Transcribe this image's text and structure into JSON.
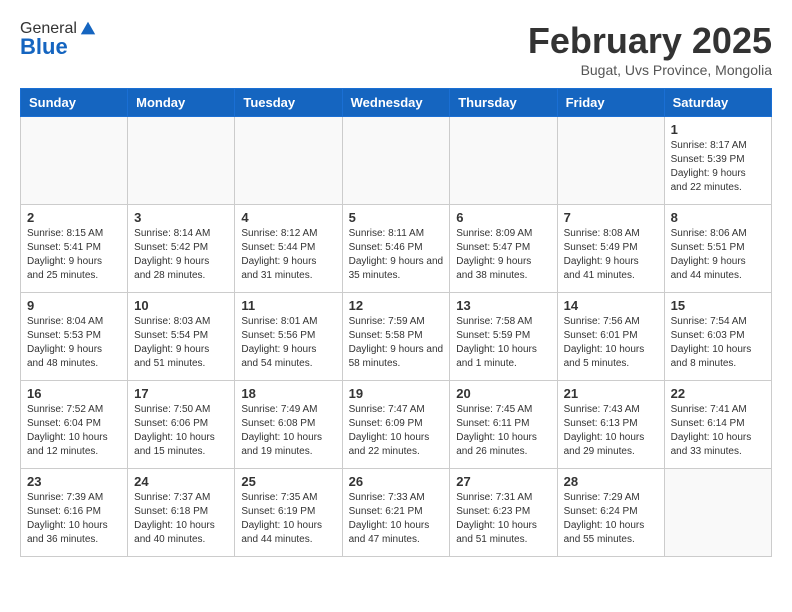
{
  "header": {
    "logo_general": "General",
    "logo_blue": "Blue",
    "month_title": "February 2025",
    "location": "Bugat, Uvs Province, Mongolia"
  },
  "days_of_week": [
    "Sunday",
    "Monday",
    "Tuesday",
    "Wednesday",
    "Thursday",
    "Friday",
    "Saturday"
  ],
  "weeks": [
    [
      {
        "day": "",
        "info": ""
      },
      {
        "day": "",
        "info": ""
      },
      {
        "day": "",
        "info": ""
      },
      {
        "day": "",
        "info": ""
      },
      {
        "day": "",
        "info": ""
      },
      {
        "day": "",
        "info": ""
      },
      {
        "day": "1",
        "info": "Sunrise: 8:17 AM\nSunset: 5:39 PM\nDaylight: 9 hours and 22 minutes."
      }
    ],
    [
      {
        "day": "2",
        "info": "Sunrise: 8:15 AM\nSunset: 5:41 PM\nDaylight: 9 hours and 25 minutes."
      },
      {
        "day": "3",
        "info": "Sunrise: 8:14 AM\nSunset: 5:42 PM\nDaylight: 9 hours and 28 minutes."
      },
      {
        "day": "4",
        "info": "Sunrise: 8:12 AM\nSunset: 5:44 PM\nDaylight: 9 hours and 31 minutes."
      },
      {
        "day": "5",
        "info": "Sunrise: 8:11 AM\nSunset: 5:46 PM\nDaylight: 9 hours and 35 minutes."
      },
      {
        "day": "6",
        "info": "Sunrise: 8:09 AM\nSunset: 5:47 PM\nDaylight: 9 hours and 38 minutes."
      },
      {
        "day": "7",
        "info": "Sunrise: 8:08 AM\nSunset: 5:49 PM\nDaylight: 9 hours and 41 minutes."
      },
      {
        "day": "8",
        "info": "Sunrise: 8:06 AM\nSunset: 5:51 PM\nDaylight: 9 hours and 44 minutes."
      }
    ],
    [
      {
        "day": "9",
        "info": "Sunrise: 8:04 AM\nSunset: 5:53 PM\nDaylight: 9 hours and 48 minutes."
      },
      {
        "day": "10",
        "info": "Sunrise: 8:03 AM\nSunset: 5:54 PM\nDaylight: 9 hours and 51 minutes."
      },
      {
        "day": "11",
        "info": "Sunrise: 8:01 AM\nSunset: 5:56 PM\nDaylight: 9 hours and 54 minutes."
      },
      {
        "day": "12",
        "info": "Sunrise: 7:59 AM\nSunset: 5:58 PM\nDaylight: 9 hours and 58 minutes."
      },
      {
        "day": "13",
        "info": "Sunrise: 7:58 AM\nSunset: 5:59 PM\nDaylight: 10 hours and 1 minute."
      },
      {
        "day": "14",
        "info": "Sunrise: 7:56 AM\nSunset: 6:01 PM\nDaylight: 10 hours and 5 minutes."
      },
      {
        "day": "15",
        "info": "Sunrise: 7:54 AM\nSunset: 6:03 PM\nDaylight: 10 hours and 8 minutes."
      }
    ],
    [
      {
        "day": "16",
        "info": "Sunrise: 7:52 AM\nSunset: 6:04 PM\nDaylight: 10 hours and 12 minutes."
      },
      {
        "day": "17",
        "info": "Sunrise: 7:50 AM\nSunset: 6:06 PM\nDaylight: 10 hours and 15 minutes."
      },
      {
        "day": "18",
        "info": "Sunrise: 7:49 AM\nSunset: 6:08 PM\nDaylight: 10 hours and 19 minutes."
      },
      {
        "day": "19",
        "info": "Sunrise: 7:47 AM\nSunset: 6:09 PM\nDaylight: 10 hours and 22 minutes."
      },
      {
        "day": "20",
        "info": "Sunrise: 7:45 AM\nSunset: 6:11 PM\nDaylight: 10 hours and 26 minutes."
      },
      {
        "day": "21",
        "info": "Sunrise: 7:43 AM\nSunset: 6:13 PM\nDaylight: 10 hours and 29 minutes."
      },
      {
        "day": "22",
        "info": "Sunrise: 7:41 AM\nSunset: 6:14 PM\nDaylight: 10 hours and 33 minutes."
      }
    ],
    [
      {
        "day": "23",
        "info": "Sunrise: 7:39 AM\nSunset: 6:16 PM\nDaylight: 10 hours and 36 minutes."
      },
      {
        "day": "24",
        "info": "Sunrise: 7:37 AM\nSunset: 6:18 PM\nDaylight: 10 hours and 40 minutes."
      },
      {
        "day": "25",
        "info": "Sunrise: 7:35 AM\nSunset: 6:19 PM\nDaylight: 10 hours and 44 minutes."
      },
      {
        "day": "26",
        "info": "Sunrise: 7:33 AM\nSunset: 6:21 PM\nDaylight: 10 hours and 47 minutes."
      },
      {
        "day": "27",
        "info": "Sunrise: 7:31 AM\nSunset: 6:23 PM\nDaylight: 10 hours and 51 minutes."
      },
      {
        "day": "28",
        "info": "Sunrise: 7:29 AM\nSunset: 6:24 PM\nDaylight: 10 hours and 55 minutes."
      },
      {
        "day": "",
        "info": ""
      }
    ]
  ]
}
